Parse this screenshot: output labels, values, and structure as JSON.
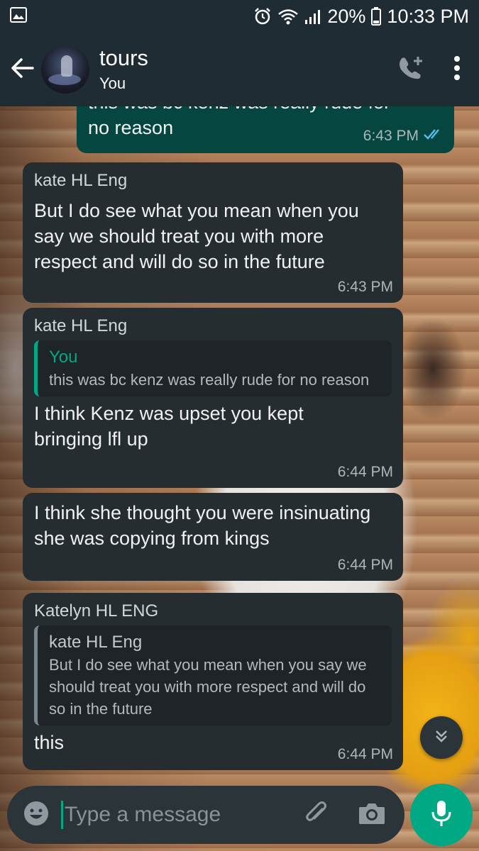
{
  "status_bar": {
    "battery": "20%",
    "time": "10:33 PM",
    "icons": [
      "image-icon",
      "alarm-icon",
      "wifi-icon",
      "signal-icon",
      "battery-icon"
    ]
  },
  "header": {
    "contact_name": "tours",
    "subtitle": "You",
    "icons": [
      "back-arrow-icon",
      "add-call-icon",
      "more-vert-icon"
    ]
  },
  "messages": [
    {
      "direction": "outgoing",
      "text_partial": "this was bc kenz was really rude for",
      "text": "no reason",
      "time": "6:43 PM",
      "status_icon": "double-check-icon"
    },
    {
      "direction": "incoming",
      "sender": "kate HL Eng",
      "text": "But I do see what you mean when you say we should treat you with more respect and will do so in the future",
      "time": "6:43 PM"
    },
    {
      "direction": "incoming",
      "sender": "kate HL Eng",
      "quote_author": "You",
      "quote_text": "this was bc kenz was really rude for no reason",
      "text": "I think Kenz was upset you kept bringing lfl up",
      "time": "6:44 PM"
    },
    {
      "direction": "incoming",
      "text": "I think she thought you were insinuating she was copying from kings",
      "time": "6:44 PM"
    },
    {
      "direction": "incoming",
      "sender": "Katelyn HL ENG",
      "quote_author": "kate HL Eng",
      "quote_text": "But I do see what you mean when you say we should treat you with more respect and will do so in the future",
      "text": "this",
      "time": "6:44 PM"
    }
  ],
  "input": {
    "placeholder": "Type a message",
    "icons": [
      "emoji-icon",
      "attach-icon",
      "camera-icon",
      "mic-icon"
    ]
  },
  "colors": {
    "bar": "#1f2c34",
    "incoming_bubble": "#262d31",
    "outgoing_bubble": "#054740",
    "accent": "#00a884",
    "read_tick": "#53bdeb"
  }
}
